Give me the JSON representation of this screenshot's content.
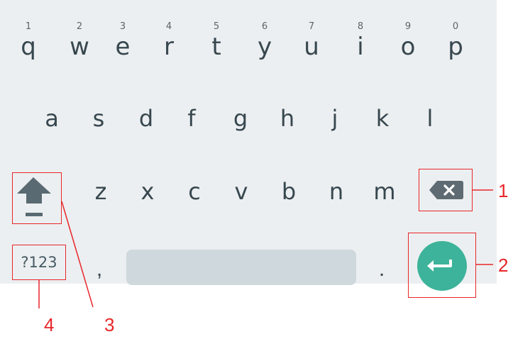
{
  "keyboard": {
    "row1": [
      {
        "hint": "1",
        "char": "q"
      },
      {
        "hint": "2",
        "char": "w"
      },
      {
        "hint": "3",
        "char": "e"
      },
      {
        "hint": "4",
        "char": "r"
      },
      {
        "hint": "5",
        "char": "t"
      },
      {
        "hint": "6",
        "char": "y"
      },
      {
        "hint": "7",
        "char": "u"
      },
      {
        "hint": "8",
        "char": "i"
      },
      {
        "hint": "9",
        "char": "o"
      },
      {
        "hint": "0",
        "char": "p"
      }
    ],
    "row2": [
      "a",
      "s",
      "d",
      "f",
      "g",
      "h",
      "j",
      "k",
      "l"
    ],
    "row3": [
      "z",
      "x",
      "c",
      "v",
      "b",
      "n",
      "m"
    ],
    "symbols_label": "?123",
    "comma": ",",
    "period": ".",
    "colors": {
      "background": "#eceff1",
      "enter": "#3cb39a",
      "spacebar": "#cfd8dc",
      "annotation": "#e8262a"
    }
  },
  "annotations": {
    "backspace": "1",
    "enter": "2",
    "shift": "3",
    "symbols": "4"
  }
}
